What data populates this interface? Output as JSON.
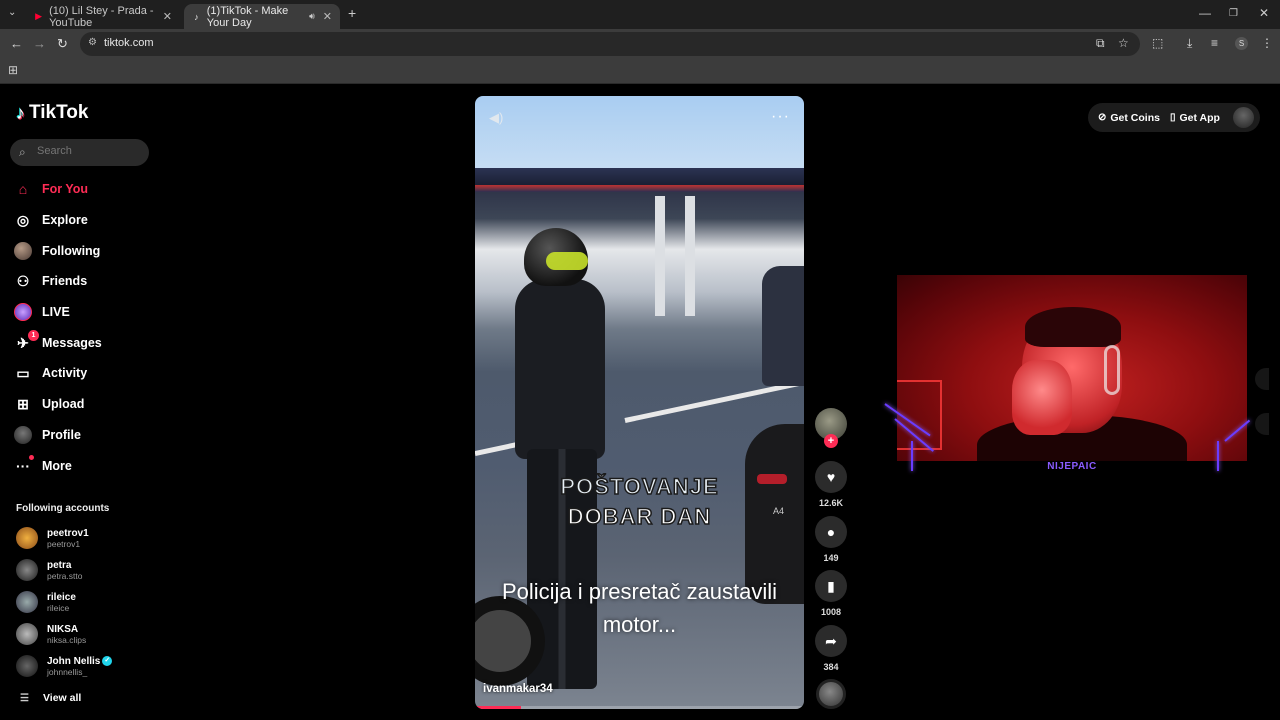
{
  "browser": {
    "tabs": [
      {
        "title": "(10) Lil Stey - Prada - YouTube",
        "active": false
      },
      {
        "title": "(1)TikTok - Make Your Day",
        "active": true
      }
    ],
    "url": "tiktok.com",
    "profile_initial": "S"
  },
  "sidebar": {
    "logo_text": "TikTok",
    "search_placeholder": "Search",
    "menu": [
      {
        "label": "For You",
        "icon": "home-icon",
        "active": true
      },
      {
        "label": "Explore",
        "icon": "compass-icon"
      },
      {
        "label": "Following",
        "icon": "following-avatar"
      },
      {
        "label": "Friends",
        "icon": "friends-icon"
      },
      {
        "label": "LIVE",
        "icon": "live-icon"
      },
      {
        "label": "Messages",
        "icon": "messages-icon",
        "badge": "1"
      },
      {
        "label": "Activity",
        "icon": "activity-icon"
      },
      {
        "label": "Upload",
        "icon": "upload-icon"
      },
      {
        "label": "Profile",
        "icon": "profile-avatar"
      },
      {
        "label": "More",
        "icon": "more-icon"
      }
    ],
    "following_title": "Following accounts",
    "accounts": [
      {
        "name": "peetrov1",
        "username": "peetrov1",
        "color": "#c4722c"
      },
      {
        "name": "petra",
        "username": "petra.stto",
        "color": "#3a3a3a"
      },
      {
        "name": "rileice",
        "username": "rileice",
        "color": "#556060"
      },
      {
        "name": "NIKSA",
        "username": "niksa.clips",
        "color": "#6a6a6a"
      },
      {
        "name": "John Nellis",
        "username": "johnnellis_",
        "color": "#2a2a2a",
        "verified": true
      }
    ],
    "view_all": "View all"
  },
  "video": {
    "overlay_line1": "POŠTOVANJE",
    "overlay_line2": "DOBAR DAN",
    "caption": "Policija i presretač zaustavili motor...",
    "author": "ivanmakar34",
    "progress_fraction": 0.14,
    "car_badge": "A4"
  },
  "actions": {
    "likes": "12.6K",
    "comments": "149",
    "saves": "1008",
    "shares": "384"
  },
  "topbar": {
    "get_coins": "Get Coins",
    "get_app": "Get App"
  },
  "webcam": {
    "nickname": "NIJEPAIC"
  },
  "colors": {
    "brand": "#fe2c55",
    "brand_cyan": "#25f4ee",
    "neon_purple": "#6a3cff"
  }
}
